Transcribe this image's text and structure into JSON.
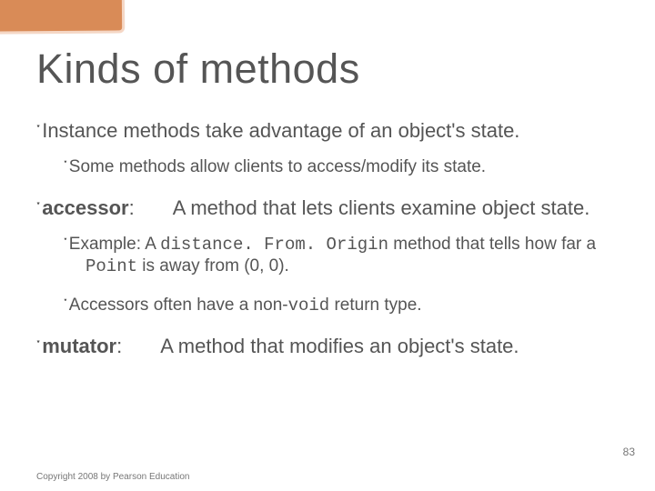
{
  "title": "Kinds of methods",
  "bullets": {
    "b1": "Instance methods take advantage of an object's state.",
    "b1a": "Some methods allow clients to access/modify its state.",
    "b2_term": "accessor",
    "b2_colon": ":",
    "b2_def": "A method that lets clients examine object state.",
    "b2a_lead": "Example: A ",
    "b2a_code1": "distance. From. Origin",
    "b2a_mid": " method that tells how far a ",
    "b2a_code2": "Point",
    "b2a_tail": " is away from (0, 0).",
    "b2b_lead": "Accessors often have a non-",
    "b2b_code": "void",
    "b2b_tail": " return type.",
    "b3_term": "mutator",
    "b3_colon": ":",
    "b3_def": "A method that modifies an object's state."
  },
  "bullet_marker": "་",
  "footer": "Copyright 2008 by Pearson Education",
  "page_number": "83"
}
